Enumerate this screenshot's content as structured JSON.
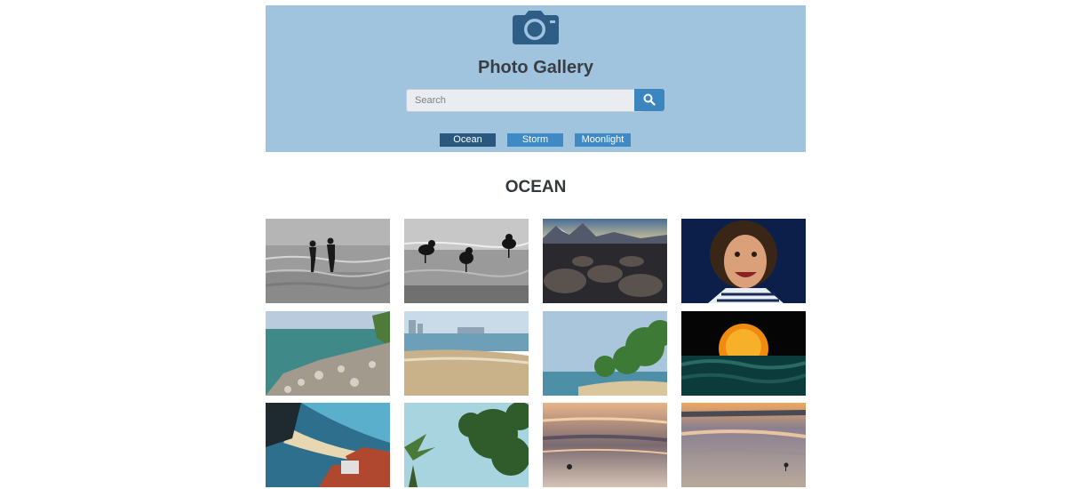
{
  "header": {
    "icon": "camera-icon",
    "title": "Photo Gallery",
    "background": "#a0c4de"
  },
  "search": {
    "placeholder": "Search",
    "value": "",
    "button_icon": "magnifier-icon"
  },
  "tags": [
    {
      "label": "Ocean",
      "active": true
    },
    {
      "label": "Storm",
      "active": false
    },
    {
      "label": "Moonlight",
      "active": false
    }
  ],
  "section": {
    "title": "OCEAN"
  },
  "colors": {
    "accent": "#3f8ac4",
    "active_tag": "#2a577d",
    "title_text": "#383e44"
  },
  "gallery": [
    {
      "subject": "two children silhouetted wading in silver ocean water"
    },
    {
      "subject": "seagulls standing on wet sand"
    },
    {
      "subject": "smooth boulders on shore at dusk with mountains"
    },
    {
      "subject": "laughing child with curly hair in striped shirt"
    },
    {
      "subject": "rocky shoreline with green sea"
    },
    {
      "subject": "sandy beach with city buildings"
    },
    {
      "subject": "tropical beach with green trees"
    },
    {
      "subject": "orange sun setting over dark waves"
    },
    {
      "subject": "coastal town rooftops above beach"
    },
    {
      "subject": "palm fronds and leaves against blue sky"
    },
    {
      "subject": "sunset over wet sandy beach"
    },
    {
      "subject": "orange sunset reflected on wet sand"
    }
  ]
}
